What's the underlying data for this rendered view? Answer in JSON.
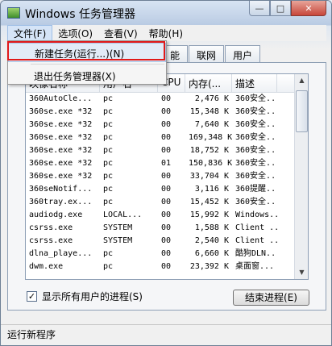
{
  "window": {
    "title": "Windows 任务管理器"
  },
  "title_buttons": {
    "minimize": "—",
    "maximize": "□",
    "close": "✕"
  },
  "menubar": {
    "items": [
      "文件(F)",
      "选项(O)",
      "查看(V)",
      "帮助(H)"
    ]
  },
  "tabs": [
    "能",
    "联网",
    "用户"
  ],
  "dropdown": {
    "items": [
      "新建任务(运行...)(N)",
      "退出任务管理器(X)"
    ]
  },
  "process_list": {
    "columns": [
      "映像名称",
      "用户名",
      "CPU",
      "内存(...",
      "描述"
    ],
    "rows": [
      [
        "360AutoCle...",
        "pc",
        "00",
        "2,476 K",
        "360安全..."
      ],
      [
        "360se.exe *32",
        "pc",
        "00",
        "15,348 K",
        "360安全..."
      ],
      [
        "360se.exe *32",
        "pc",
        "00",
        "7,640 K",
        "360安全..."
      ],
      [
        "360se.exe *32",
        "pc",
        "00",
        "169,348 K",
        "360安全..."
      ],
      [
        "360se.exe *32",
        "pc",
        "00",
        "18,752 K",
        "360安全..."
      ],
      [
        "360se.exe *32",
        "pc",
        "01",
        "150,836 K",
        "360安全..."
      ],
      [
        "360se.exe *32",
        "pc",
        "00",
        "33,704 K",
        "360安全..."
      ],
      [
        "360seNotif...",
        "pc",
        "00",
        "3,116 K",
        "360提醒..."
      ],
      [
        "360tray.ex...",
        "pc",
        "00",
        "15,452 K",
        "360安全..."
      ],
      [
        "audiodg.exe",
        "LOCAL...",
        "00",
        "15,992 K",
        "Windows..."
      ],
      [
        "csrss.exe",
        "SYSTEM",
        "00",
        "1,588 K",
        "Client ..."
      ],
      [
        "csrss.exe",
        "SYSTEM",
        "00",
        "2,540 K",
        "Client ..."
      ],
      [
        "dlna_playe...",
        "pc",
        "00",
        "6,660 K",
        "酷狗DLN..."
      ],
      [
        "dwm.exe",
        "pc",
        "00",
        "23,392 K",
        "桌面窗..."
      ]
    ]
  },
  "checkbox": {
    "label": "显示所有用户的进程(S)",
    "checked_mark": "✓"
  },
  "end_process_button": "结束进程(E)",
  "status": "运行新程序",
  "scroll": {
    "up": "▲",
    "down": "▼"
  }
}
